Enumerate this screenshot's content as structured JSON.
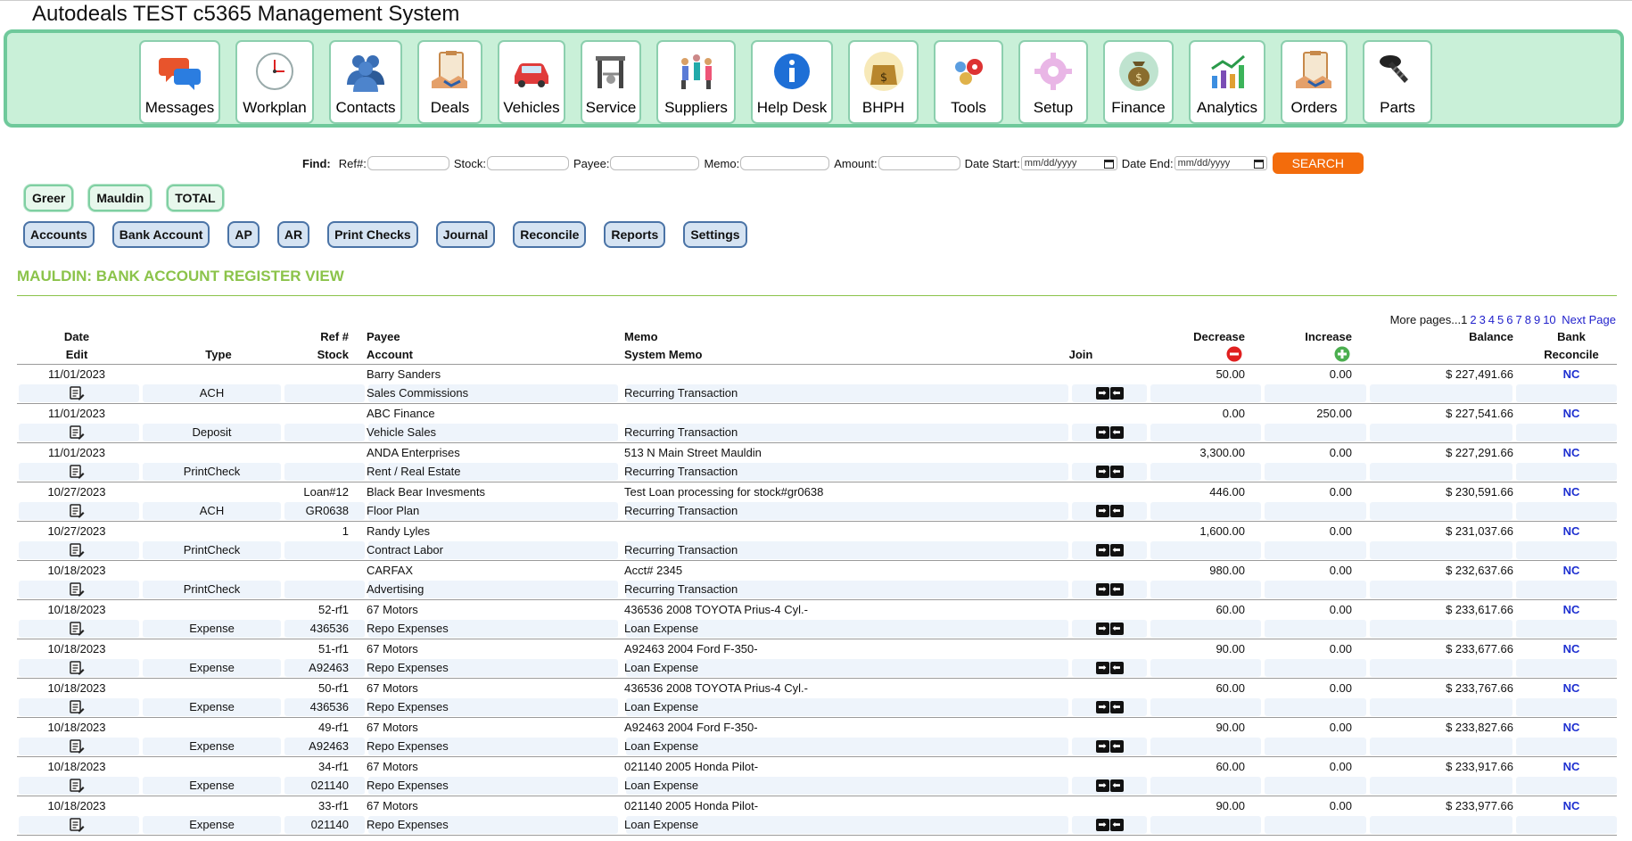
{
  "app": {
    "title": "Autodeals TEST c5365 Management System"
  },
  "nav": [
    {
      "label": "Messages",
      "icon": "messages-icon"
    },
    {
      "label": "Workplan",
      "icon": "clock-icon"
    },
    {
      "label": "Contacts",
      "icon": "contacts-icon"
    },
    {
      "label": "Deals",
      "icon": "deals-icon"
    },
    {
      "label": "Vehicles",
      "icon": "car-icon"
    },
    {
      "label": "Service",
      "icon": "service-icon"
    },
    {
      "label": "Suppliers",
      "icon": "suppliers-icon"
    },
    {
      "label": "Help Desk",
      "icon": "info-icon"
    },
    {
      "label": "BHPH",
      "icon": "money-bag-icon"
    },
    {
      "label": "Tools",
      "icon": "gears-icon"
    },
    {
      "label": "Setup",
      "icon": "setup-gear-icon"
    },
    {
      "label": "Finance",
      "icon": "finance-bag-icon"
    },
    {
      "label": "Analytics",
      "icon": "analytics-icon"
    },
    {
      "label": "Orders",
      "icon": "orders-icon"
    },
    {
      "label": "Parts",
      "icon": "screw-icon"
    }
  ],
  "find": {
    "label": "Find:",
    "ref_label": "Ref#:",
    "stock_label": "Stock:",
    "payee_label": "Payee:",
    "memo_label": "Memo:",
    "amount_label": "Amount:",
    "date_start_label": "Date Start:",
    "date_end_label": "Date End:",
    "date_placeholder": "mm/dd/yyyy",
    "search_label": "SEARCH"
  },
  "stores": [
    "Greer",
    "Mauldin",
    "TOTAL"
  ],
  "subnav": [
    "Accounts",
    "Bank Account",
    "AP",
    "AR",
    "Print Checks",
    "Journal",
    "Reconcile",
    "Reports",
    "Settings"
  ],
  "section_title": "MAULDIN: BANK ACCOUNT REGISTER VIEW",
  "pager": {
    "prefix": "More pages...",
    "current": "1",
    "pages": [
      "2",
      "3",
      "4",
      "5",
      "6",
      "7",
      "8",
      "9",
      "10"
    ],
    "next": "Next Page"
  },
  "headers": {
    "date": "Date",
    "edit": "Edit",
    "type": "Type",
    "ref": "Ref #",
    "stock": "Stock",
    "payee": "Payee",
    "account": "Account",
    "memo": "Memo",
    "system_memo": "System Memo",
    "join": "Join",
    "decrease": "Decrease",
    "increase": "Increase",
    "balance": "Balance",
    "bank": "Bank",
    "reconcile": "Reconcile"
  },
  "rows": [
    {
      "date": "11/01/2023",
      "type": "ACH",
      "ref": "",
      "stock": "",
      "payee": "Barry Sanders",
      "account": "Sales Commissions",
      "memo": "",
      "system_memo": "Recurring Transaction",
      "decrease": "50.00",
      "increase": "0.00",
      "balance": "$ 227,491.66",
      "reconcile": "NC"
    },
    {
      "date": "11/01/2023",
      "type": "Deposit",
      "ref": "",
      "stock": "",
      "payee": "ABC Finance",
      "account": "Vehicle Sales",
      "memo": "",
      "system_memo": "Recurring Transaction",
      "decrease": "0.00",
      "increase": "250.00",
      "balance": "$ 227,541.66",
      "reconcile": "NC"
    },
    {
      "date": "11/01/2023",
      "type": "PrintCheck",
      "ref": "",
      "stock": "",
      "payee": "ANDA Enterprises",
      "account": "Rent / Real Estate",
      "memo": "513 N Main Street Mauldin",
      "system_memo": "Recurring Transaction",
      "decrease": "3,300.00",
      "increase": "0.00",
      "balance": "$ 227,291.66",
      "reconcile": "NC"
    },
    {
      "date": "10/27/2023",
      "type": "ACH",
      "ref": "Loan#12",
      "stock": "GR0638",
      "payee": "Black Bear Invesments",
      "account": "Floor Plan",
      "memo": "Test Loan processing for stock#gr0638",
      "system_memo": "Recurring Transaction",
      "decrease": "446.00",
      "increase": "0.00",
      "balance": "$ 230,591.66",
      "reconcile": "NC"
    },
    {
      "date": "10/27/2023",
      "type": "PrintCheck",
      "ref": "1",
      "stock": "",
      "payee": "Randy Lyles",
      "account": "Contract Labor",
      "memo": "",
      "system_memo": "Recurring Transaction",
      "decrease": "1,600.00",
      "increase": "0.00",
      "balance": "$ 231,037.66",
      "reconcile": "NC"
    },
    {
      "date": "10/18/2023",
      "type": "PrintCheck",
      "ref": "",
      "stock": "",
      "payee": "CARFAX",
      "account": "Advertising",
      "memo": "Acct# 2345",
      "system_memo": "Recurring Transaction",
      "decrease": "980.00",
      "increase": "0.00",
      "balance": "$ 232,637.66",
      "reconcile": "NC"
    },
    {
      "date": "10/18/2023",
      "type": "Expense",
      "ref": "52-rf1",
      "stock": "436536",
      "payee": "67 Motors",
      "account": "Repo Expenses",
      "memo": "436536 2008 TOYOTA Prius-4 Cyl.-",
      "system_memo": "Loan Expense",
      "decrease": "60.00",
      "increase": "0.00",
      "balance": "$ 233,617.66",
      "reconcile": "NC"
    },
    {
      "date": "10/18/2023",
      "type": "Expense",
      "ref": "51-rf1",
      "stock": "A92463",
      "payee": "67 Motors",
      "account": "Repo Expenses",
      "memo": "A92463 2004 Ford F-350-",
      "system_memo": "Loan Expense",
      "decrease": "90.00",
      "increase": "0.00",
      "balance": "$ 233,677.66",
      "reconcile": "NC"
    },
    {
      "date": "10/18/2023",
      "type": "Expense",
      "ref": "50-rf1",
      "stock": "436536",
      "payee": "67 Motors",
      "account": "Repo Expenses",
      "memo": "436536 2008 TOYOTA Prius-4 Cyl.-",
      "system_memo": "Loan Expense",
      "decrease": "60.00",
      "increase": "0.00",
      "balance": "$ 233,767.66",
      "reconcile": "NC"
    },
    {
      "date": "10/18/2023",
      "type": "Expense",
      "ref": "49-rf1",
      "stock": "A92463",
      "payee": "67 Motors",
      "account": "Repo Expenses",
      "memo": "A92463 2004 Ford F-350-",
      "system_memo": "Loan Expense",
      "decrease": "90.00",
      "increase": "0.00",
      "balance": "$ 233,827.66",
      "reconcile": "NC"
    },
    {
      "date": "10/18/2023",
      "type": "Expense",
      "ref": "34-rf1",
      "stock": "021140",
      "payee": "67 Motors",
      "account": "Repo Expenses",
      "memo": "021140 2005 Honda Pilot-",
      "system_memo": "Loan Expense",
      "decrease": "60.00",
      "increase": "0.00",
      "balance": "$ 233,917.66",
      "reconcile": "NC"
    },
    {
      "date": "10/18/2023",
      "type": "Expense",
      "ref": "33-rf1",
      "stock": "021140",
      "payee": "67 Motors",
      "account": "Repo Expenses",
      "memo": "021140 2005 Honda Pilot-",
      "system_memo": "Loan Expense",
      "decrease": "90.00",
      "increase": "0.00",
      "balance": "$ 233,977.66",
      "reconcile": "NC"
    }
  ]
}
